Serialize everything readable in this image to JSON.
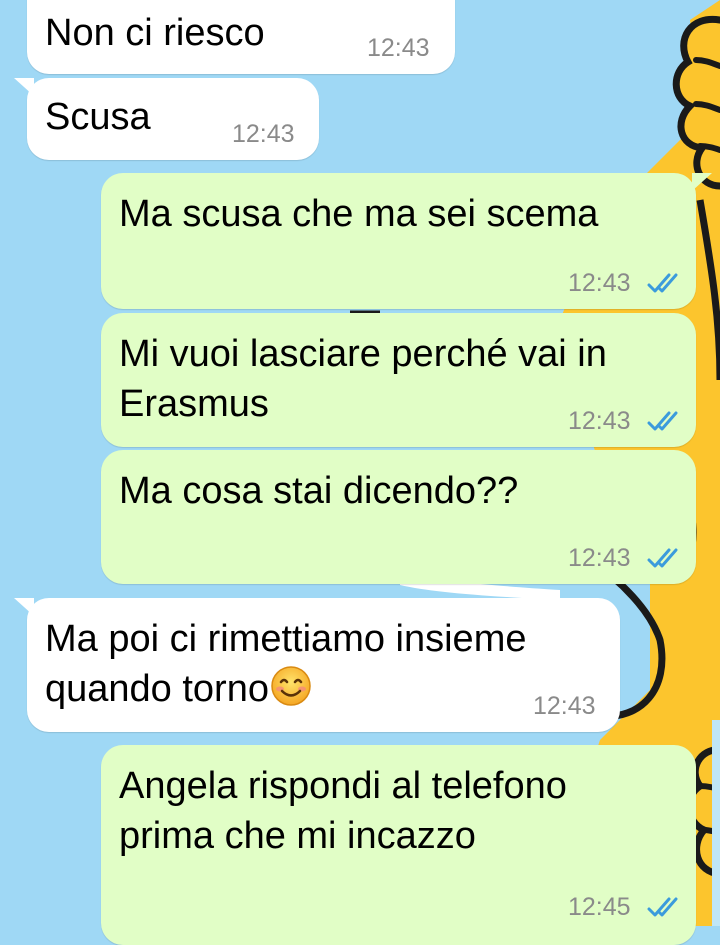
{
  "chat": {
    "messages": [
      {
        "direction": "incoming",
        "lines": [
          "Non ci riesco"
        ],
        "time": "12:43"
      },
      {
        "direction": "incoming",
        "lines": [
          "Scusa"
        ],
        "time": "12:43"
      },
      {
        "direction": "outgoing",
        "lines": [
          "Ma scusa che ma sei scema"
        ],
        "time": "12:43",
        "status": "read"
      },
      {
        "direction": "outgoing",
        "lines": [
          "Mi vuoi lasciare perché vai in",
          "Erasmus"
        ],
        "time": "12:43",
        "status": "read"
      },
      {
        "direction": "outgoing",
        "lines": [
          "Ma cosa stai dicendo??"
        ],
        "time": "12:43",
        "status": "read"
      },
      {
        "direction": "incoming",
        "lines": [
          "Ma poi ci rimettiamo insieme",
          "quando torno"
        ],
        "emoji": "smiling-face-emoji",
        "time": "12:43"
      },
      {
        "direction": "outgoing",
        "lines": [
          "Angela rispondi al telefono",
          "prima che mi incazzo"
        ],
        "time": "12:45",
        "status": "read"
      }
    ]
  },
  "colors": {
    "wallpaper_blue": "#9fd8f5",
    "cartoon_yellow": "#fcc52d",
    "incoming_bubble": "#ffffff",
    "outgoing_bubble": "#e1fec6",
    "timestamp": "#8a8a8a",
    "read_ticks": "#3b9bdc"
  }
}
